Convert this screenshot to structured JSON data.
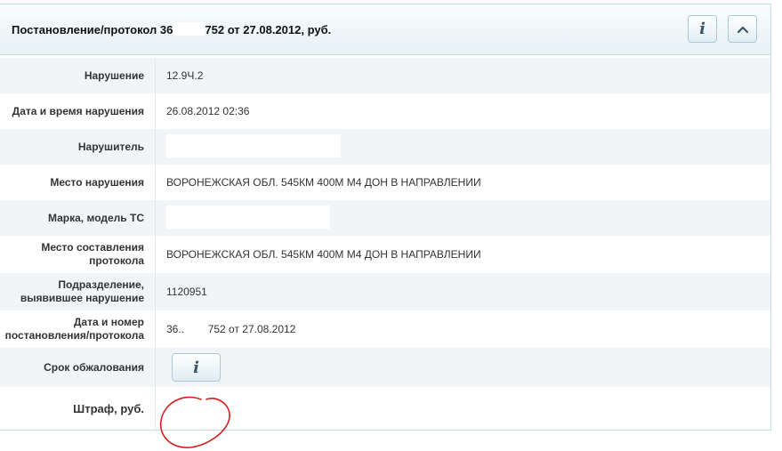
{
  "header": {
    "title_prefix": "Постановление/протокол 36",
    "title_suffix": "752 от 27.08.2012, руб.",
    "info_icon": "info-icon",
    "collapse_icon": "chevron-up-icon"
  },
  "rows": [
    {
      "label": "Нарушение",
      "value": "12.9Ч.2"
    },
    {
      "label": "Дата и время нарушения",
      "value": "26.08.2012 02:36"
    },
    {
      "label": "Нарушитель",
      "value": ""
    },
    {
      "label": "Место нарушения",
      "value": "ВОРОНЕЖСКАЯ ОБЛ. 545КМ 400М М4 ДОН В НАПРАВЛЕНИИ"
    },
    {
      "label": "Марка, модель ТС",
      "value": ""
    },
    {
      "label_line1": "Место составления",
      "label_line2": "протокола",
      "value": "ВОРОНЕЖСКАЯ ОБЛ. 545КМ 400М М4 ДОН В НАПРАВЛЕНИИ"
    },
    {
      "label_line1": "Подразделение,",
      "label_line2": "выявившее нарушение",
      "value": "1120951"
    },
    {
      "label_line1": "Дата и номер",
      "label_line2": "постановления/протокола",
      "value": "36..        752 от 27.08.2012"
    },
    {
      "label": "Срок обжалования",
      "button_icon": "info-icon"
    },
    {
      "label": "Штраф, руб.",
      "value": ""
    }
  ],
  "colors": {
    "alt_row": "#f1f5f7",
    "border": "#c6dde6",
    "annotation": "#d42020"
  }
}
